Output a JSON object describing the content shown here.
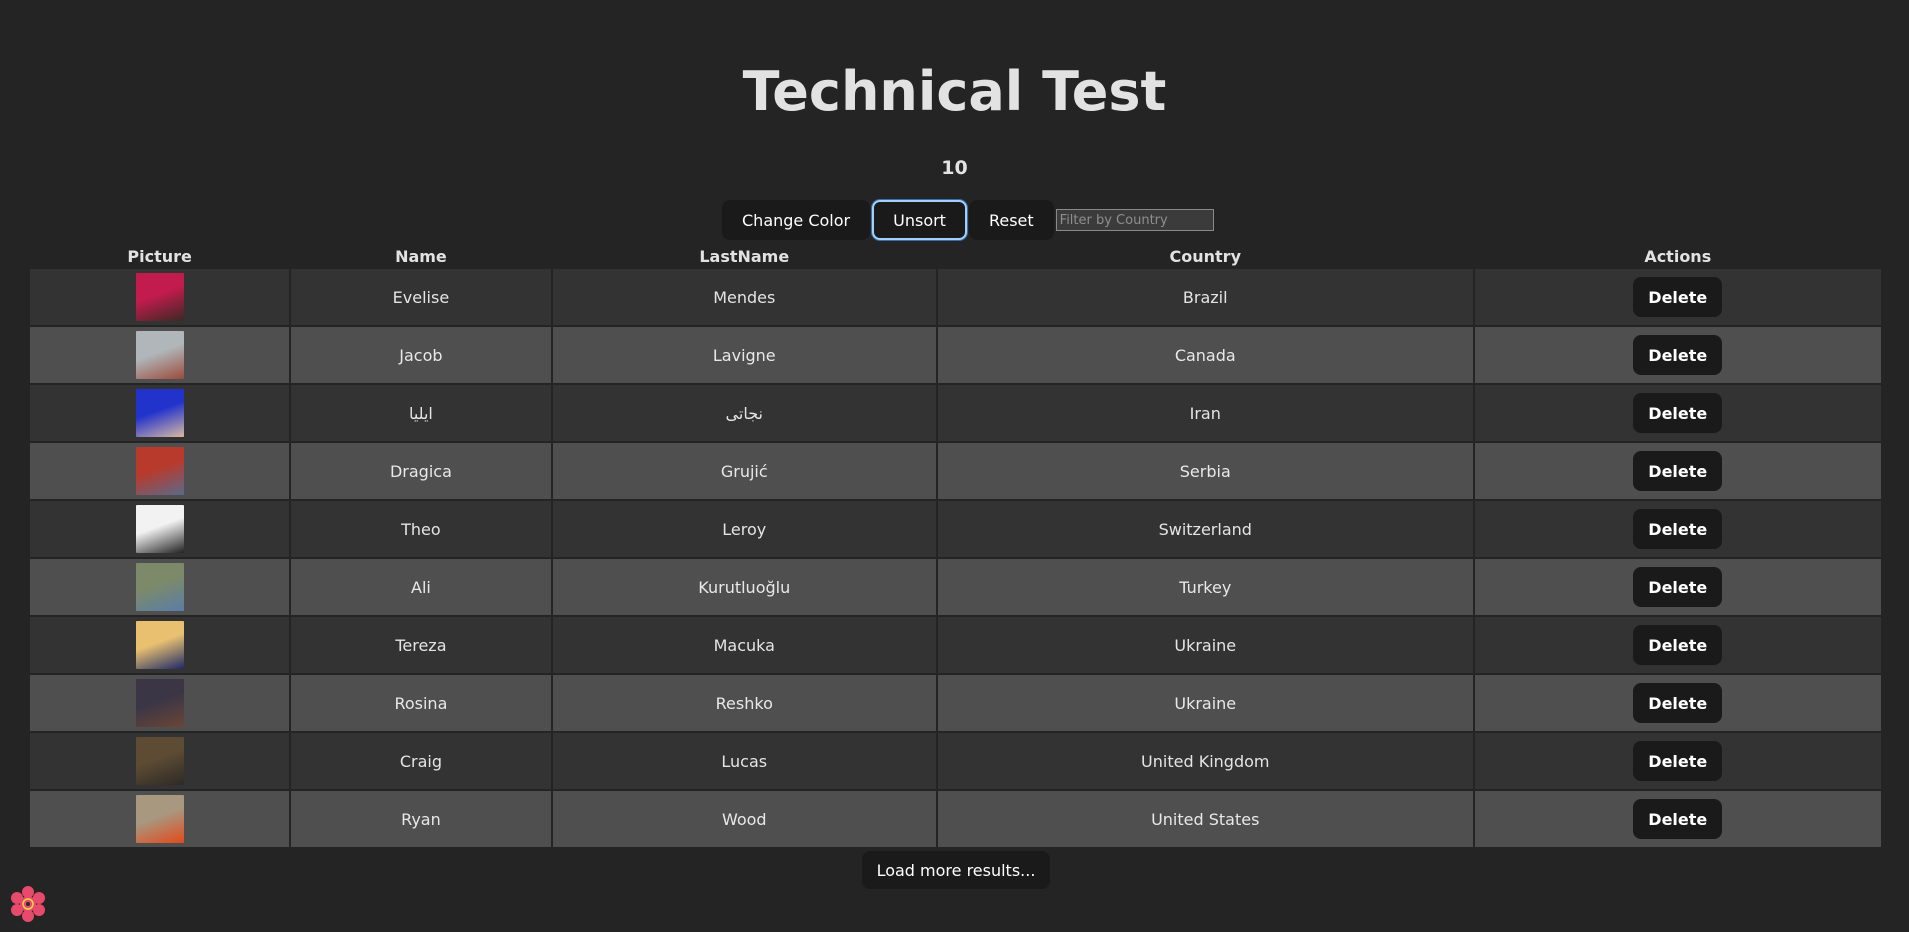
{
  "page": {
    "title": "Technical Test",
    "count": "10"
  },
  "toolbar": {
    "change_color_label": "Change Color",
    "unsort_label": "Unsort",
    "reset_label": "Reset",
    "filter_placeholder": "Filter by Country"
  },
  "table": {
    "headers": [
      "Picture",
      "Name",
      "LastName",
      "Country",
      "Actions"
    ],
    "rows": [
      {
        "name": "Evelise",
        "last": "Mendes",
        "country": "Brazil",
        "action": "Delete",
        "avatar_colors": [
          "#c21b4e",
          "#3a2a22"
        ]
      },
      {
        "name": "Jacob",
        "last": "Lavigne",
        "country": "Canada",
        "action": "Delete",
        "avatar_colors": [
          "#b0b6ba",
          "#9b4b3b"
        ]
      },
      {
        "name": "ایلیا",
        "last": "نجاتی",
        "country": "Iran",
        "action": "Delete",
        "avatar_colors": [
          "#2233cc",
          "#d9b9a3"
        ]
      },
      {
        "name": "Dragica",
        "last": "Grujić",
        "country": "Serbia",
        "action": "Delete",
        "avatar_colors": [
          "#b83a2c",
          "#5b6a8a"
        ]
      },
      {
        "name": "Theo",
        "last": "Leroy",
        "country": "Switzerland",
        "action": "Delete",
        "avatar_colors": [
          "#f2f2f2",
          "#222222"
        ]
      },
      {
        "name": "Ali",
        "last": "Kurutluoğlu",
        "country": "Turkey",
        "action": "Delete",
        "avatar_colors": [
          "#7c8a6a",
          "#5a7da8"
        ]
      },
      {
        "name": "Tereza",
        "last": "Macuka",
        "country": "Ukraine",
        "action": "Delete",
        "avatar_colors": [
          "#e8c070",
          "#1c2a66"
        ]
      },
      {
        "name": "Rosina",
        "last": "Reshko",
        "country": "Ukraine",
        "action": "Delete",
        "avatar_colors": [
          "#3a3646",
          "#6b4536"
        ]
      },
      {
        "name": "Craig",
        "last": "Lucas",
        "country": "United Kingdom",
        "action": "Delete",
        "avatar_colors": [
          "#5d4b33",
          "#2c2a26"
        ]
      },
      {
        "name": "Ryan",
        "last": "Wood",
        "country": "United States",
        "action": "Delete",
        "avatar_colors": [
          "#a89880",
          "#e24a1a"
        ]
      }
    ]
  },
  "footer": {
    "load_more_label": "Load more results..."
  },
  "colors": {
    "background": "#242424",
    "row_odd": "#333333",
    "row_even": "#4f4f4f",
    "button_bg": "#1a1a1a",
    "focus_ring": "#9fd0ff",
    "logo": "#e84a6b"
  },
  "icons": {
    "logo": "flower-logo-icon"
  }
}
